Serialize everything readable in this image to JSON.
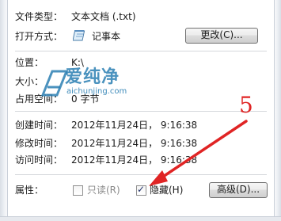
{
  "rows": {
    "file_type": {
      "label": "文件类型：",
      "value": "文本文档 (.txt)"
    },
    "opens_with": {
      "label": "打开方式：",
      "value": "记事本",
      "button": "更改(C)..."
    },
    "location": {
      "label": "位置：",
      "value": "K:\\"
    },
    "size": {
      "label": "大小：",
      "value": ""
    },
    "size_on_disk": {
      "label": "占用空间：",
      "value": "0 字节"
    },
    "created": {
      "label": "创建时间：",
      "value": "2012年11月24日， 9:16:38"
    },
    "modified": {
      "label": "修改时间：",
      "value": "2012年11月24日， 9:16:38"
    },
    "accessed": {
      "label": "访问时间：",
      "value": "2012年11月24日， 9:16:38"
    }
  },
  "attributes": {
    "label": "属性：",
    "readonly": {
      "label": "只读(R)",
      "checked": false
    },
    "hidden": {
      "label": "隐藏(H)",
      "checked": true
    },
    "advanced_button": "高级(D)..."
  },
  "watermark": {
    "text": "爱纯净",
    "url": "aichunjing.com"
  },
  "annotation": {
    "step_number": "5",
    "color": "#e02424"
  },
  "icons": {
    "opens_with_app": "notepad-icon",
    "checkmark": "✓"
  }
}
